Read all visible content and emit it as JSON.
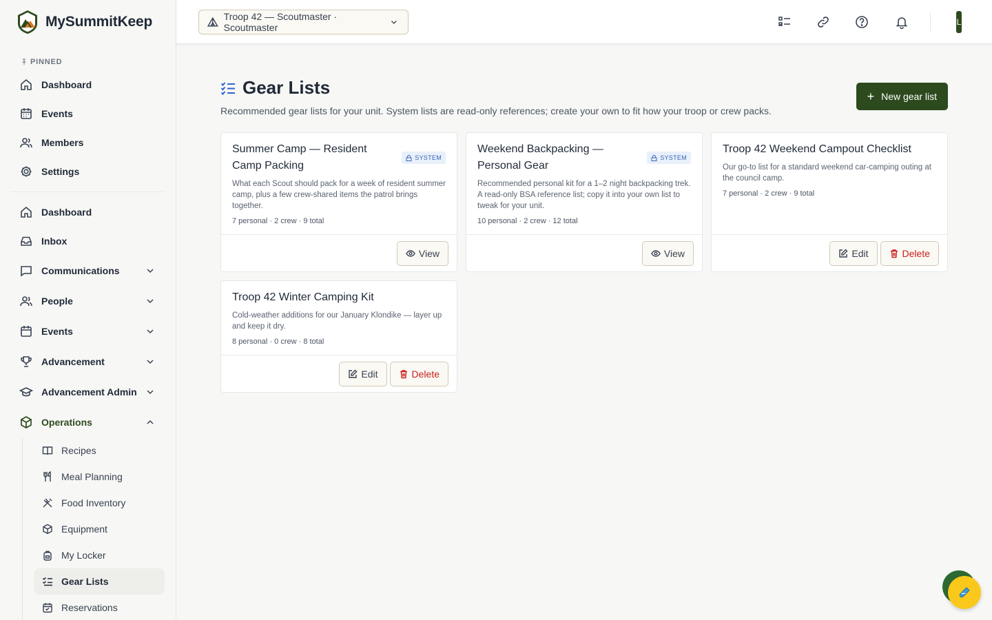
{
  "brand": {
    "name": "MySummitKeep"
  },
  "sidebar": {
    "pinned_label": "PINNED",
    "pinned": [
      {
        "label": "Dashboard",
        "icon": "home-icon"
      },
      {
        "label": "Events",
        "icon": "calendar-icon"
      },
      {
        "label": "Members",
        "icon": "users-icon"
      },
      {
        "label": "Settings",
        "icon": "gear-icon"
      }
    ],
    "main": [
      {
        "label": "Dashboard",
        "icon": "home-icon"
      },
      {
        "label": "Inbox",
        "icon": "inbox-icon"
      },
      {
        "label": "Communications",
        "icon": "message-icon"
      },
      {
        "label": "People",
        "icon": "users-icon"
      },
      {
        "label": "Events",
        "icon": "calendar-icon"
      },
      {
        "label": "Advancement",
        "icon": "trophy-icon"
      },
      {
        "label": "Advancement Admin",
        "icon": "graduation-cap-icon"
      },
      {
        "label": "Operations",
        "icon": "box-icon"
      }
    ],
    "operations": [
      {
        "label": "Recipes",
        "icon": "book-icon"
      },
      {
        "label": "Meal Planning",
        "icon": "utensils-icon"
      },
      {
        "label": "Food Inventory",
        "icon": "fork-knife-cross-icon"
      },
      {
        "label": "Equipment",
        "icon": "package-icon"
      },
      {
        "label": "My Locker",
        "icon": "backpack-icon"
      },
      {
        "label": "Gear Lists",
        "icon": "checklist-icon"
      },
      {
        "label": "Reservations",
        "icon": "calendar-check-icon"
      }
    ]
  },
  "topbar": {
    "unit_selector": "Troop 42 — Scoutmaster · Scoutmaster",
    "avatar_initial": "L"
  },
  "page": {
    "title": "Gear Lists",
    "subtitle": "Recommended gear lists for your unit. System lists are read-only references; create your own to fit how your troop or crew packs.",
    "new_button": "New gear list"
  },
  "cards": [
    {
      "title": "Summer Camp — Resident Camp Packing",
      "badge": "SYSTEM",
      "desc": "What each Scout should pack for a week of resident summer camp, plus a few crew-shared items the patrol brings together.",
      "meta": "7 personal · 2 crew · 9 total",
      "view": "View"
    },
    {
      "title": "Weekend Backpacking — Personal Gear",
      "badge": "SYSTEM",
      "desc": "Recommended personal kit for a 1–2 night backpacking trek. A read-only BSA reference list; copy it into your own list to tweak for your unit.",
      "meta": "10 personal · 2 crew · 12 total",
      "view": "View"
    },
    {
      "title": "Troop 42 Weekend Campout Checklist",
      "desc": "Our go-to list for a standard weekend car-camping outing at the council camp.",
      "meta": "7 personal · 2 crew · 9 total",
      "edit": "Edit",
      "delete": "Delete"
    },
    {
      "title": "Troop 42 Winter Camping Kit",
      "desc": "Cold-weather additions for our January Klondike — layer up and keep it dry.",
      "meta": "8 personal · 0 crew · 8 total",
      "edit": "Edit",
      "delete": "Delete"
    }
  ],
  "colors": {
    "brand": "#2d4a1e",
    "system_badge": "#3b64b5",
    "danger": "#c81e1e",
    "fab": "#f9c81a"
  }
}
